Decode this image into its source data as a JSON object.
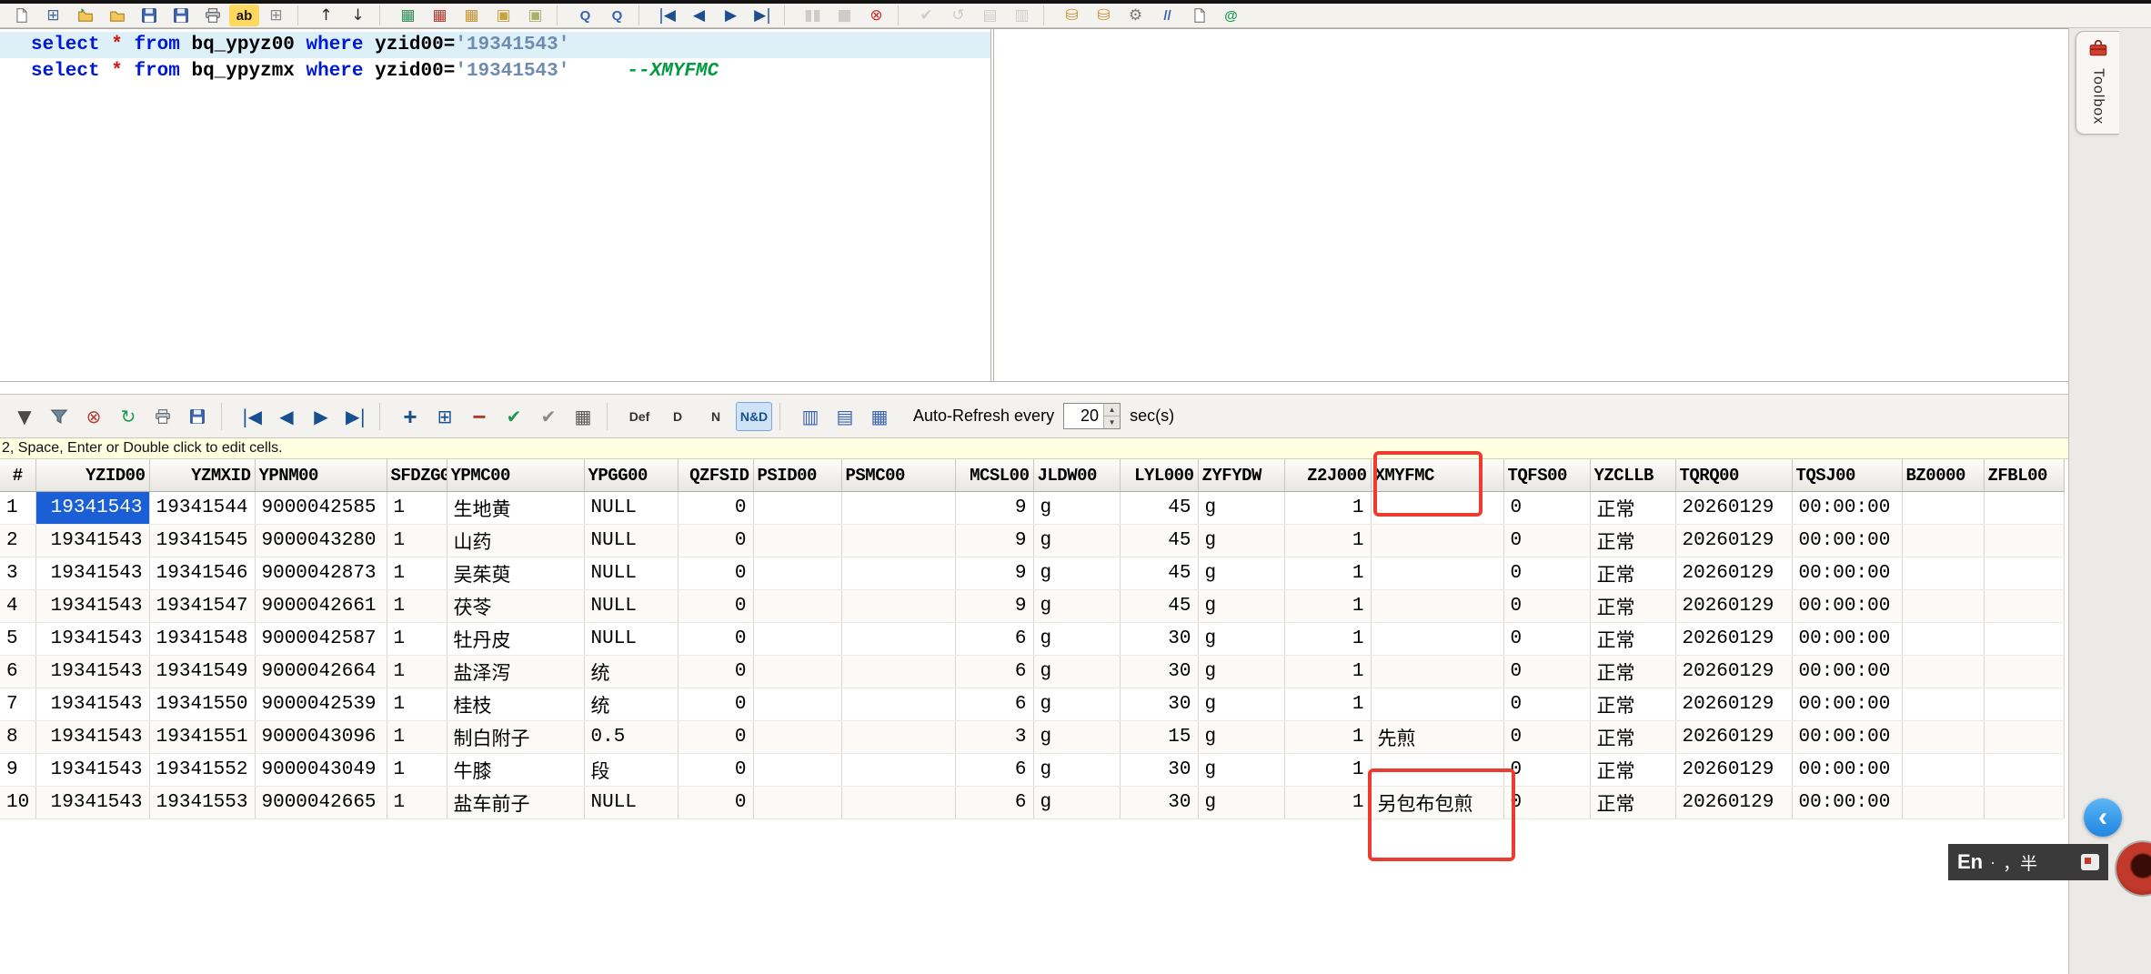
{
  "window": {
    "toolbox_tab": "Toolbox"
  },
  "colors": {
    "annotation_red": "#ed3b2f",
    "selection_blue": "#1a5fd6",
    "keyword_blue": "#0018d4",
    "string_blue_gray": "#6e8cb0",
    "comment_green": "#009a40",
    "star_red": "#d01818",
    "hint_bar_yellow": "#ffffe1"
  },
  "main_toolbar": {
    "icons": [
      {
        "name": "new-file",
        "svg": "page"
      },
      {
        "name": "new-query-window",
        "glyph": "⊞",
        "color": "#46689a"
      },
      {
        "name": "open-file",
        "svg": "folder-open"
      },
      {
        "name": "open-folder",
        "svg": "folder"
      },
      {
        "name": "save",
        "svg": "floppy"
      },
      {
        "name": "save-all",
        "svg": "floppy"
      },
      {
        "name": "print",
        "svg": "printer"
      },
      {
        "name": "find-highlight",
        "glyph": "ab",
        "color": "#1a1a1a",
        "bg": "#ffd95e",
        "text": true
      },
      {
        "name": "window-grid",
        "glyph": "⊞",
        "color": "#8a8a8a"
      },
      {
        "sep": true
      },
      {
        "name": "move-up",
        "glyph": "↑",
        "color": "#2a2a2a"
      },
      {
        "name": "move-down",
        "glyph": "↓",
        "color": "#2a2a2a"
      },
      {
        "sep": true
      },
      {
        "name": "table-data",
        "glyph": "▦",
        "color": "#2f8f57"
      },
      {
        "name": "table-structure",
        "glyph": "▦",
        "color": "#b03a30"
      },
      {
        "name": "table-keys",
        "glyph": "▦",
        "color": "#c8922e"
      },
      {
        "name": "lock",
        "glyph": "▣",
        "color": "#c8a23e"
      },
      {
        "name": "lock-open",
        "glyph": "▣",
        "color": "#a8b06a"
      },
      {
        "sep": true
      },
      {
        "name": "query-builder",
        "glyph": "Q",
        "color": "#3a62b0",
        "text": true
      },
      {
        "name": "query-results",
        "glyph": "Q",
        "color": "#3a62b0",
        "text": true
      },
      {
        "sep": true
      },
      {
        "name": "nav-first",
        "glyph": "|◀",
        "color": "#1d4f8c"
      },
      {
        "name": "nav-prev",
        "glyph": "◀",
        "color": "#1d4f8c"
      },
      {
        "name": "nav-next",
        "glyph": "▶",
        "color": "#1d4f8c"
      },
      {
        "name": "nav-last",
        "glyph": "▶|",
        "color": "#1d4f8c"
      },
      {
        "sep": true
      },
      {
        "name": "pause",
        "glyph": "▮▮",
        "color": "#9a9a9a",
        "disabled": true
      },
      {
        "name": "stop",
        "glyph": "■",
        "color": "#9a9a9a",
        "disabled": true
      },
      {
        "name": "abort",
        "glyph": "⊗",
        "color": "#c53026"
      },
      {
        "sep": true
      },
      {
        "name": "commit",
        "glyph": "✔",
        "color": "#9a9a9a",
        "disabled": true
      },
      {
        "name": "rollback",
        "glyph": "↺",
        "color": "#9a9a9a",
        "disabled": true
      },
      {
        "name": "copy-results",
        "glyph": "▤",
        "color": "#9a9a9a",
        "disabled": true
      },
      {
        "name": "paste-results",
        "glyph": "▥",
        "color": "#9a9a9a",
        "disabled": true
      },
      {
        "sep": true
      },
      {
        "name": "database",
        "glyph": "⛁",
        "color": "#c8922e"
      },
      {
        "name": "database-export",
        "glyph": "⛁",
        "color": "#c8922e"
      },
      {
        "name": "settings-gear",
        "glyph": "⚙",
        "color": "#7a7a7a"
      },
      {
        "name": "comment-lines",
        "glyph": "//",
        "color": "#3a62b0",
        "text": true
      },
      {
        "name": "script",
        "svg": "page"
      },
      {
        "name": "connect-web",
        "glyph": "@",
        "color": "#1f9a50",
        "text": true
      }
    ]
  },
  "editor": {
    "current_line": 0,
    "lines": [
      [
        {
          "t": "select",
          "c": "kw"
        },
        {
          "t": " ",
          "c": "pl"
        },
        {
          "t": "*",
          "c": "star"
        },
        {
          "t": " ",
          "c": "pl"
        },
        {
          "t": "from",
          "c": "kw"
        },
        {
          "t": " bq_ypyz00 ",
          "c": "pl"
        },
        {
          "t": "where",
          "c": "kw"
        },
        {
          "t": " yzid00=",
          "c": "pl"
        },
        {
          "t": "'19341543'",
          "c": "str"
        }
      ],
      [
        {
          "t": "select",
          "c": "kw"
        },
        {
          "t": " ",
          "c": "pl"
        },
        {
          "t": "*",
          "c": "star"
        },
        {
          "t": " ",
          "c": "pl"
        },
        {
          "t": "from",
          "c": "kw"
        },
        {
          "t": " bq_ypyzmx ",
          "c": "pl"
        },
        {
          "t": "where",
          "c": "kw"
        },
        {
          "t": " yzid00=",
          "c": "pl"
        },
        {
          "t": "'19341543'",
          "c": "str"
        },
        {
          "t": "     ",
          "c": "pl"
        },
        {
          "t": "--XMYFMC",
          "c": "cmt"
        }
      ]
    ]
  },
  "result_toolbar": {
    "icons": [
      {
        "name": "filter-dropdown",
        "glyph": "▼",
        "color": "#4a4a4a"
      },
      {
        "name": "filter",
        "svg": "funnel"
      },
      {
        "name": "filter-clear",
        "glyph": "⊗",
        "color": "#b04038"
      },
      {
        "name": "refresh",
        "glyph": "↻",
        "color": "#1f9a50"
      },
      {
        "name": "print-results",
        "svg": "printer"
      },
      {
        "name": "save-results",
        "svg": "floppy"
      },
      {
        "sep": true
      },
      {
        "name": "record-first",
        "glyph": "|◀",
        "color": "#17508f"
      },
      {
        "name": "record-prev",
        "glyph": "◀",
        "color": "#17508f"
      },
      {
        "name": "record-next",
        "glyph": "▶",
        "color": "#17508f"
      },
      {
        "name": "record-last",
        "glyph": "▶|",
        "color": "#17508f"
      },
      {
        "sep": true
      },
      {
        "name": "insert-record",
        "glyph": "+",
        "color": "#17508f",
        "text": true,
        "big": true
      },
      {
        "name": "append-record",
        "glyph": "⊞",
        "color": "#17508f"
      },
      {
        "name": "delete-record",
        "glyph": "−",
        "color": "#b03a30",
        "text": true,
        "big": true
      },
      {
        "name": "post-edit",
        "glyph": "✔",
        "color": "#1f9a50"
      },
      {
        "name": "cancel-edit",
        "glyph": "✔",
        "color": "#8a8a8a"
      },
      {
        "name": "grid-options",
        "glyph": "▦",
        "color": "#565656"
      },
      {
        "sep": true
      },
      {
        "name": "show-defaults",
        "glyph": "Def",
        "color": "#333333",
        "text": true,
        "small": true
      },
      {
        "name": "sort-d",
        "glyph": "D",
        "color": "#333333",
        "text": true,
        "small": true
      },
      {
        "name": "sort-n",
        "glyph": "N",
        "color": "#333333",
        "text": true,
        "small": true
      },
      {
        "name": "sort-nd",
        "glyph": "N&D",
        "color": "#17508f",
        "text": true,
        "small": true,
        "active": true
      },
      {
        "sep": true
      },
      {
        "name": "view-grid",
        "glyph": "▥",
        "color": "#3a62b0"
      },
      {
        "name": "view-list",
        "glyph": "▤",
        "color": "#3a62b0"
      },
      {
        "name": "fit-columns",
        "glyph": "▦",
        "color": "#3a62b0"
      }
    ],
    "auto_refresh_label": "Auto-Refresh every",
    "interval_value": "20",
    "interval_unit": "sec(s)",
    "spinner_up": "▲",
    "spinner_down": "▼"
  },
  "hint_text": "2, Space, Enter or Double click to edit cells.",
  "grid": {
    "columns": [
      "#",
      "YZID00",
      "YZMXID",
      "YPNM00",
      "SFDZGG",
      "YPMC00",
      "YPGG00",
      "QZFSID",
      "PSID00",
      "PSMC00",
      "MCSL00",
      "JLDW00",
      "LYL000",
      "ZYFYDW",
      "Z2J000",
      "XMYFMC",
      "TQFS00",
      "YZCLLB",
      "TQRQ00",
      "TQSJ00",
      "BZ0000",
      "ZFBL00"
    ],
    "selected": {
      "row_index": 0,
      "column": "YZID00"
    },
    "rows": [
      [
        "1",
        "19341543",
        "19341544",
        "9000042585",
        "1",
        "生地黄",
        "NULL",
        "0",
        "",
        "",
        "9",
        "g",
        "45",
        "g",
        "1",
        "",
        "0",
        "正常",
        "20260129",
        "00:00:00",
        "",
        ""
      ],
      [
        "2",
        "19341543",
        "19341545",
        "9000043280",
        "1",
        "山药",
        "NULL",
        "0",
        "",
        "",
        "9",
        "g",
        "45",
        "g",
        "1",
        "",
        "0",
        "正常",
        "20260129",
        "00:00:00",
        "",
        ""
      ],
      [
        "3",
        "19341543",
        "19341546",
        "9000042873",
        "1",
        "吴茱萸",
        "NULL",
        "0",
        "",
        "",
        "9",
        "g",
        "45",
        "g",
        "1",
        "",
        "0",
        "正常",
        "20260129",
        "00:00:00",
        "",
        ""
      ],
      [
        "4",
        "19341543",
        "19341547",
        "9000042661",
        "1",
        "茯苓",
        "NULL",
        "0",
        "",
        "",
        "9",
        "g",
        "45",
        "g",
        "1",
        "",
        "0",
        "正常",
        "20260129",
        "00:00:00",
        "",
        ""
      ],
      [
        "5",
        "19341543",
        "19341548",
        "9000042587",
        "1",
        "牡丹皮",
        "NULL",
        "0",
        "",
        "",
        "6",
        "g",
        "30",
        "g",
        "1",
        "",
        "0",
        "正常",
        "20260129",
        "00:00:00",
        "",
        ""
      ],
      [
        "6",
        "19341543",
        "19341549",
        "9000042664",
        "1",
        "盐泽泻",
        "统",
        "0",
        "",
        "",
        "6",
        "g",
        "30",
        "g",
        "1",
        "",
        "0",
        "正常",
        "20260129",
        "00:00:00",
        "",
        ""
      ],
      [
        "7",
        "19341543",
        "19341550",
        "9000042539",
        "1",
        "桂枝",
        "统",
        "0",
        "",
        "",
        "6",
        "g",
        "30",
        "g",
        "1",
        "",
        "0",
        "正常",
        "20260129",
        "00:00:00",
        "",
        ""
      ],
      [
        "8",
        "19341543",
        "19341551",
        "9000043096",
        "1",
        "制白附子",
        "0.5",
        "0",
        "",
        "",
        "3",
        "g",
        "15",
        "g",
        "1",
        "先煎",
        "0",
        "正常",
        "20260129",
        "00:00:00",
        "",
        ""
      ],
      [
        "9",
        "19341543",
        "19341552",
        "9000043049",
        "1",
        "牛膝",
        "段",
        "0",
        "",
        "",
        "6",
        "g",
        "30",
        "g",
        "1",
        "",
        "0",
        "正常",
        "20260129",
        "00:00:00",
        "",
        ""
      ],
      [
        "10",
        "19341543",
        "19341553",
        "9000042665",
        "1",
        "盐车前子",
        "NULL",
        "0",
        "",
        "",
        "6",
        "g",
        "30",
        "g",
        "1",
        "另包布包煎",
        "0",
        "正常",
        "20260129",
        "00:00:00",
        "",
        ""
      ]
    ]
  },
  "ime_bar": {
    "lang": "En",
    "sep": "·",
    "punct": "，半"
  },
  "assistant": {
    "chevron": "‹"
  }
}
